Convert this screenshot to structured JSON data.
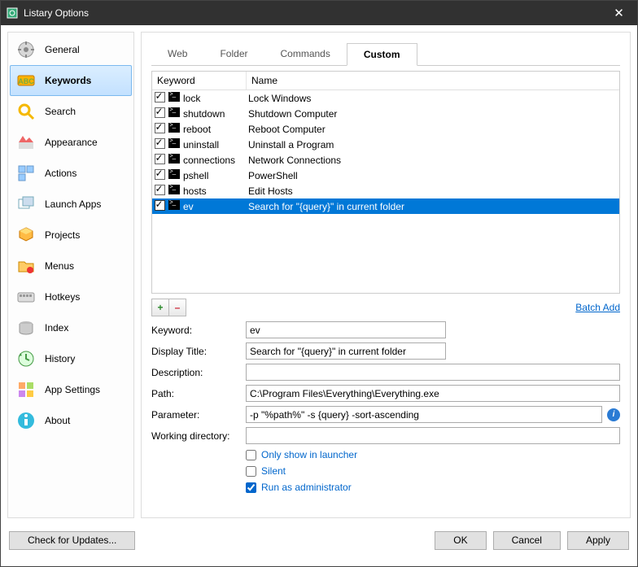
{
  "window": {
    "title": "Listary Options"
  },
  "sidebar": {
    "items": [
      {
        "label": "General"
      },
      {
        "label": "Keywords"
      },
      {
        "label": "Search"
      },
      {
        "label": "Appearance"
      },
      {
        "label": "Actions"
      },
      {
        "label": "Launch Apps"
      },
      {
        "label": "Projects"
      },
      {
        "label": "Menus"
      },
      {
        "label": "Hotkeys"
      },
      {
        "label": "Index"
      },
      {
        "label": "History"
      },
      {
        "label": "App Settings"
      },
      {
        "label": "About"
      }
    ],
    "selected": 1
  },
  "tabs": {
    "items": [
      "Web",
      "Folder",
      "Commands",
      "Custom"
    ],
    "active": 3
  },
  "table": {
    "headers": {
      "keyword": "Keyword",
      "name": "Name"
    },
    "rows": [
      {
        "checked": true,
        "keyword": "lock",
        "name": "Lock Windows"
      },
      {
        "checked": true,
        "keyword": "shutdown",
        "name": "Shutdown Computer"
      },
      {
        "checked": true,
        "keyword": "reboot",
        "name": "Reboot Computer"
      },
      {
        "checked": true,
        "keyword": "uninstall",
        "name": "Uninstall a Program"
      },
      {
        "checked": true,
        "keyword": "connections",
        "name": "Network Connections"
      },
      {
        "checked": true,
        "keyword": "pshell",
        "name": "PowerShell"
      },
      {
        "checked": true,
        "keyword": "hosts",
        "name": "Edit Hosts"
      },
      {
        "checked": true,
        "keyword": "ev",
        "name": "Search for \"{query}\" in current folder"
      }
    ],
    "selected": 7
  },
  "buttons": {
    "add": "+",
    "remove": "–",
    "batch_add": "Batch Add"
  },
  "form": {
    "labels": {
      "keyword": "Keyword:",
      "display_title": "Display Title:",
      "description": "Description:",
      "path": "Path:",
      "parameter": "Parameter:",
      "working_dir": "Working directory:"
    },
    "values": {
      "keyword": "ev",
      "display_title": "Search for \"{query}\" in current folder",
      "description": "",
      "path": "C:\\Program Files\\Everything\\Everything.exe",
      "parameter": "-p \"%path%\" -s {query} -sort-ascending",
      "working_dir": ""
    },
    "checkboxes": {
      "only_launcher": {
        "label": "Only show in launcher",
        "checked": false
      },
      "silent": {
        "label": "Silent",
        "checked": false
      },
      "run_admin": {
        "label": "Run as administrator",
        "checked": true
      }
    }
  },
  "footer": {
    "check_updates": "Check for Updates...",
    "ok": "OK",
    "cancel": "Cancel",
    "apply": "Apply"
  }
}
